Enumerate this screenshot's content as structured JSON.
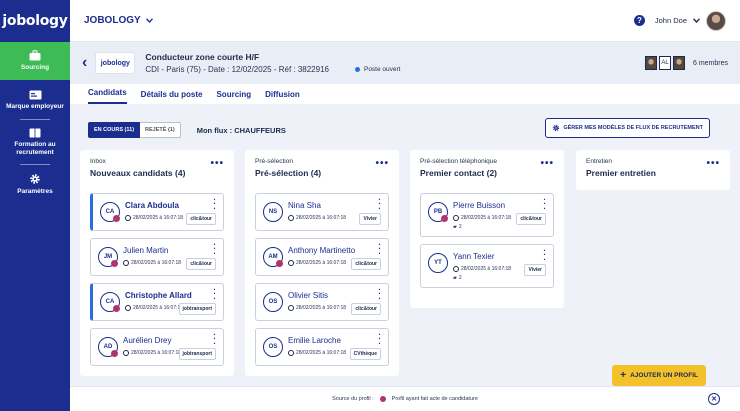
{
  "app": {
    "logo": "jobology",
    "brand_menu": "JOBOLOGY"
  },
  "sidebar": {
    "items": [
      {
        "label": "Sourcing",
        "icon": "briefcase-icon",
        "active": true
      },
      {
        "label": "Marque employeur",
        "icon": "id-card-icon",
        "active": false
      },
      {
        "label": "Formation au recrutement",
        "icon": "book-icon",
        "active": false
      },
      {
        "label": "Paramètres",
        "icon": "gear-icon",
        "active": false
      }
    ]
  },
  "topbar": {
    "help": "?",
    "user_name": "John Doe"
  },
  "job": {
    "company_logo": "jobology",
    "title": "Conducteur zone courte H/F",
    "subtitle": "CDI - Paris (75) - Date : 12/02/2025 - Réf : 3822916",
    "status": "Poste ouvert",
    "members_initials": "AL",
    "members_count": "6 membres"
  },
  "tabs": [
    "Candidats",
    "Détails du poste",
    "Sourcing",
    "Diffusion"
  ],
  "filters": {
    "en_cours": "EN COURS (11)",
    "rejete": "REJETÉ (1)",
    "flux_label": "Mon flux : CHAUFFEURS",
    "manage_label": "GÉRER MES MODÈLES DE FLUX DE RECRUTEMENT"
  },
  "columns": [
    {
      "kicker": "Inbox",
      "title": "Nouveaux candidats (4)",
      "cards": [
        {
          "initials": "CA",
          "name": "Clara Abdoula",
          "date": "28/02/2025 à 16:07:18",
          "tag": "clic&tour",
          "flag": true,
          "comments": ""
        },
        {
          "initials": "JM",
          "name": "Julien Martin",
          "date": "28/02/2025 à 16:07:18",
          "tag": "clic&tour",
          "flag": false,
          "comments": ""
        },
        {
          "initials": "CA",
          "name": "Christophe Allard",
          "date": "28/02/2025 à 16:07:18",
          "tag": "jobtransport",
          "flag": true,
          "comments": ""
        },
        {
          "initials": "AD",
          "name": "Aurélien Drey",
          "date": "28/02/2025 à 16:07:18",
          "tag": "jobtransport",
          "flag": false,
          "comments": ""
        }
      ]
    },
    {
      "kicker": "Pré-sélection",
      "title": "Pré-sélection (4)",
      "cards": [
        {
          "initials": "NS",
          "name": "Nina Sha",
          "date": "28/02/2025 à 16:07:18",
          "tag": "Vivier",
          "flag": false,
          "comments": ""
        },
        {
          "initials": "AM",
          "name": "Anthony Martinetto",
          "date": "28/02/2025 à 16:07:18",
          "tag": "clic&tour",
          "flag": false,
          "comments": ""
        },
        {
          "initials": "OS",
          "name": "Olivier Sitis",
          "date": "28/02/2025 à 16:07:18",
          "tag": "clic&tour",
          "flag": false,
          "comments": ""
        },
        {
          "initials": "OS",
          "name": "Emilie Laroche",
          "date": "28/02/2025 à 16:07:18",
          "tag": "CVthèque",
          "flag": false,
          "comments": ""
        }
      ]
    },
    {
      "kicker": "Pré-sélection téléphonique",
      "title": "Premier contact (2)",
      "cards": [
        {
          "initials": "PB",
          "name": "Pierre Buisson",
          "date": "28/02/2025 à 16:07:18",
          "tag": "clic&tour",
          "flag": false,
          "comments": "2"
        },
        {
          "initials": "YT",
          "name": "Yann Texier",
          "date": "28/02/2025 à 16:07:18",
          "tag": "Vivier",
          "flag": false,
          "comments": "2"
        }
      ]
    },
    {
      "kicker": "Entretien",
      "title": "Premier entretien",
      "cards": []
    }
  ],
  "add_profile": "AJOUTER UN PROFIL",
  "footer": {
    "source_label": "Source du profil :",
    "legend": "Profil ayant fait acte de candidature"
  },
  "colors": {
    "primary": "#1b2e8f",
    "active_nav": "#3dbb54",
    "applicant_dot": "#b0336e",
    "cta": "#f3c22a"
  }
}
